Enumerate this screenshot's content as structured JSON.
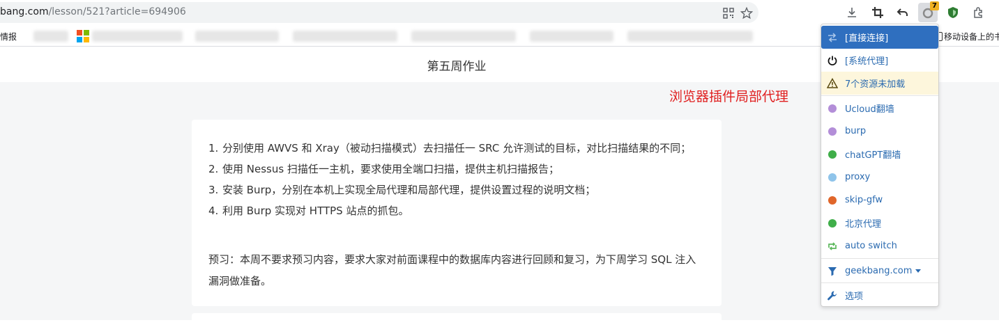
{
  "address_bar": {
    "url_host": "bang.com",
    "url_path": "/lesson/521?article=694906"
  },
  "toolbar": {
    "extension_badge": "7"
  },
  "bookmarks": {
    "first_label": "情报",
    "last_label": "移动设备上的书"
  },
  "page": {
    "title": "第五周作业",
    "annotation": "浏览器插件局部代理",
    "tasks": [
      {
        "num": "1.",
        "text": "分别使用 AWVS 和 Xray（被动扫描模式）去扫描任一 SRC 允许测试的目标，对比扫描结果的不同；"
      },
      {
        "num": "2.",
        "text": "使用 Nessus 扫描任一主机，要求使用全端口扫描，提供主机扫描报告；"
      },
      {
        "num": "3.",
        "text": "安装 Burp，分别在本机上实现全局代理和局部代理，提供设置过程的说明文档；"
      },
      {
        "num": "4.",
        "text": "利用 Burp 实现对 HTTPS 站点的抓包。"
      }
    ],
    "preview": "预习：本周不要求预习内容，要求大家对前面课程中的数据库内容进行回顾和复习，为下周学习 SQL 注入漏洞做准备。"
  },
  "proxy_menu": {
    "direct": "[直接连接]",
    "system": "[系统代理]",
    "warning": "7个资源未加载",
    "profiles": [
      {
        "label": "Ucloud翻墙",
        "color": "#b38ed8"
      },
      {
        "label": "burp",
        "color": "#b38ed8"
      },
      {
        "label": "chatGPT翻墙",
        "color": "#3fae49"
      },
      {
        "label": "proxy",
        "color": "#8fc4ea"
      },
      {
        "label": "skip-gfw",
        "color": "#e0662a"
      },
      {
        "label": "北京代理",
        "color": "#3fae49"
      }
    ],
    "auto_switch": "auto switch",
    "site": "geekbang.com",
    "options": "选项"
  }
}
